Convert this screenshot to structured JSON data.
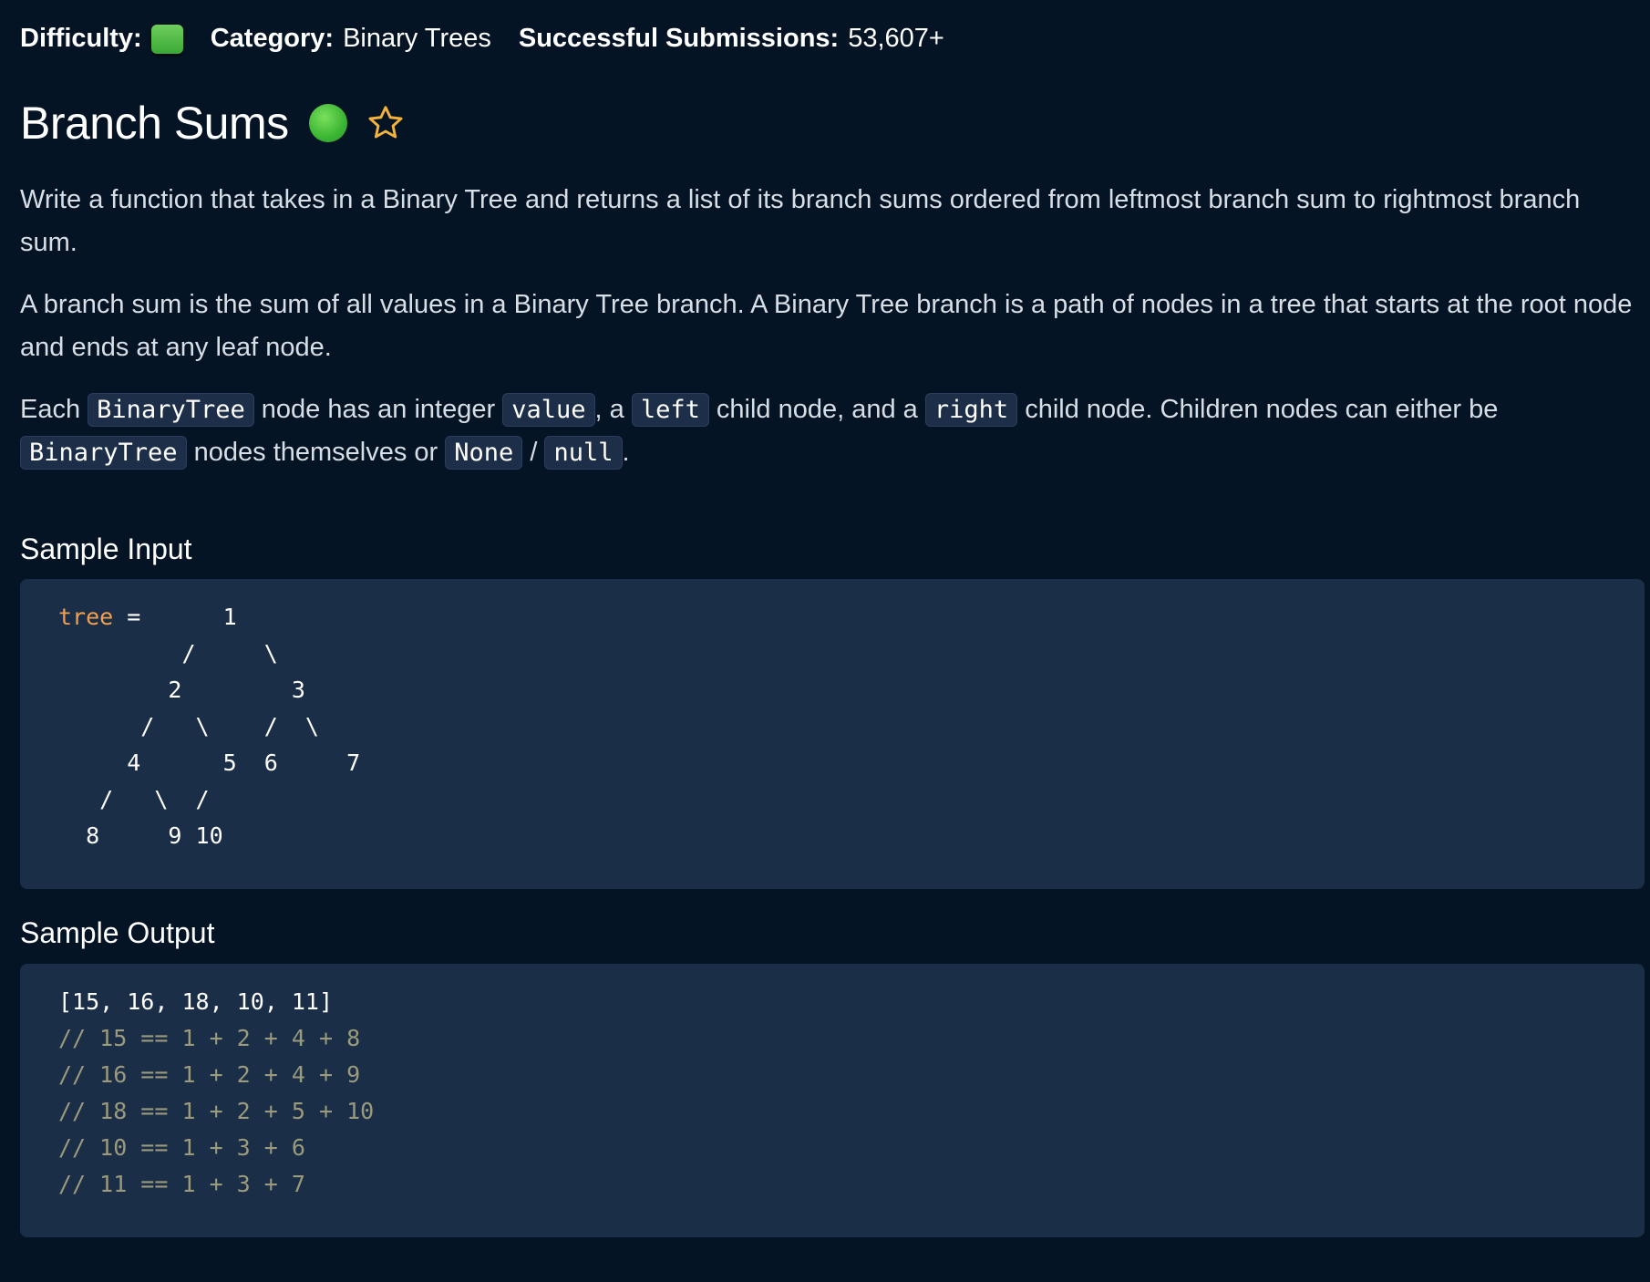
{
  "meta": {
    "difficulty_label": "Difficulty:",
    "difficulty_color": "#4fbf45",
    "category_label": "Category:",
    "category_value": "Binary Trees",
    "submissions_label": "Successful Submissions:",
    "submissions_value": "53,607+"
  },
  "title": "Branch Sums",
  "icons": {
    "status": "green-circle-icon",
    "favorite": "star-outline-icon"
  },
  "description": {
    "p1": "Write a function that takes in a Binary Tree and returns a list of its branch sums ordered from leftmost branch sum to rightmost branch sum.",
    "p2": "A branch sum is the sum of all values in a Binary Tree branch. A Binary Tree branch is a path of nodes in a tree that starts at the root node and ends at any leaf node.",
    "p3": {
      "t1": "Each ",
      "c1": "BinaryTree",
      "t2": " node has an integer ",
      "c2": "value",
      "t3": ", a ",
      "c3": "left",
      "t4": " child node, and a ",
      "c4": "right",
      "t5": " child node. Children nodes can either be ",
      "c5": "BinaryTree",
      "t6": " nodes themselves or ",
      "c6": "None",
      "t7": " / ",
      "c7": "null",
      "t8": "."
    }
  },
  "sample_input": {
    "heading": "Sample Input",
    "var_name": "tree",
    "line0_rest": " =      1",
    "lines": [
      "         /     \\",
      "        2        3",
      "      /   \\    /  \\",
      "     4      5  6     7",
      "   /   \\  /",
      "  8     9 10"
    ]
  },
  "sample_output": {
    "heading": "Sample Output",
    "result": "[15, 16, 18, 10, 11]",
    "comments": [
      "// 15 == 1 + 2 + 4 + 8",
      "// 16 == 1 + 2 + 4 + 9",
      "// 18 == 1 + 2 + 5 + 10",
      "// 10 == 1 + 3 + 6",
      "// 11 == 1 + 3 + 7"
    ]
  },
  "colors": {
    "background": "#051424",
    "code_background": "#1b2e47",
    "accent_orange": "#f0a050",
    "comment": "#9a9a7c",
    "star": "#f2b33d"
  }
}
